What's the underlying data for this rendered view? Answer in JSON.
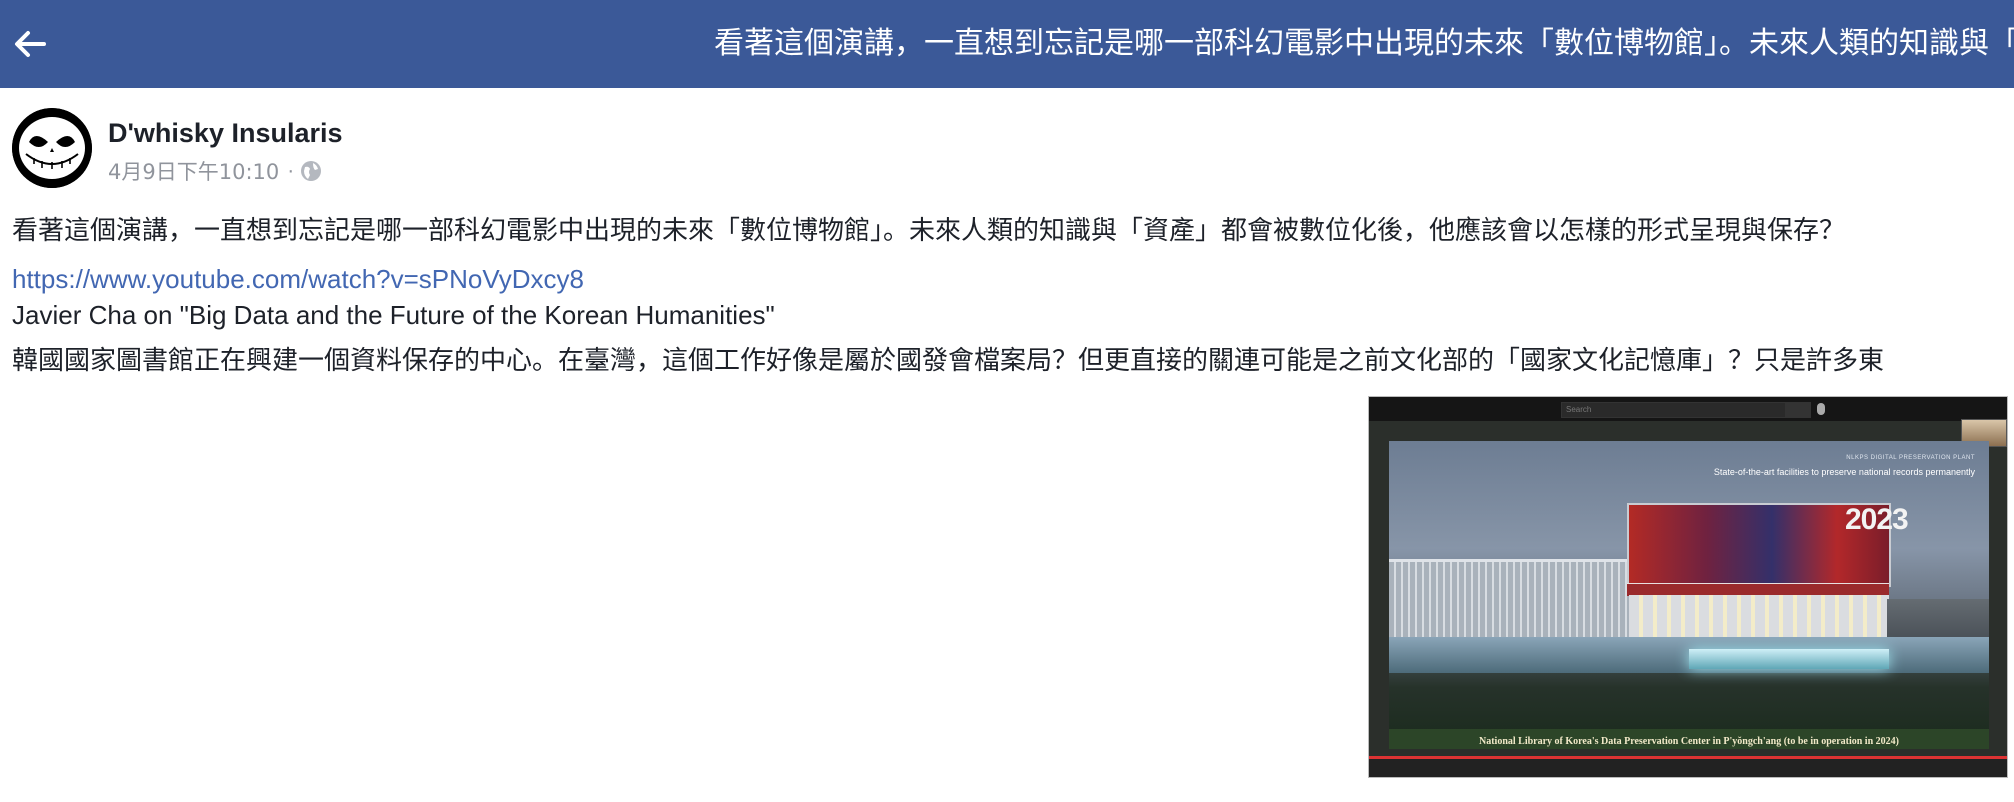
{
  "header": {
    "back_icon": "arrow-left-icon",
    "title": "看著這個演講，一直想到忘記是哪一部科幻電影中出現的未來「數位博物館」。未來人類的知識與「資產」都會被數位化後，他應該會以怎樣的形式呈現與保存？",
    "bg_color": "#3b5998"
  },
  "post": {
    "author": "D'whisky Insularis",
    "timestamp": "4月9日下午10:10",
    "separator": "·",
    "privacy_icon": "globe-icon",
    "paragraph_1": "看著這個演講，一直想到忘記是哪一部科幻電影中出現的未來「數位博物館」。未來人類的知識與「資產」都會被數位化後，他應該會以怎樣的形式呈現與保存？",
    "link": "https://www.youtube.com/watch?v=sPNoVyDxcy8",
    "video_title_line": "Javier Cha on \"Big Data and the Future of the Korean Humanities\"",
    "paragraph_2": "韓國國家圖書館正在興建一個資料保存的中心。在臺灣，這個工作好像是屬於國發會檔案局？但更直接的關連可能是之前文化部的「國家文化記憶庫」？只是許多東"
  },
  "video": {
    "search_placeholder": "Search",
    "slide_label_top": "NLKPS DIGITAL PRESERVATION PLANT",
    "slide_subtitle": "State-of-the-art facilities to preserve national records permanently",
    "year": "2023",
    "caption": "National Library of Korea's Data Preservation Center in P'yŏngch'ang (to be in operation in 2024)"
  }
}
